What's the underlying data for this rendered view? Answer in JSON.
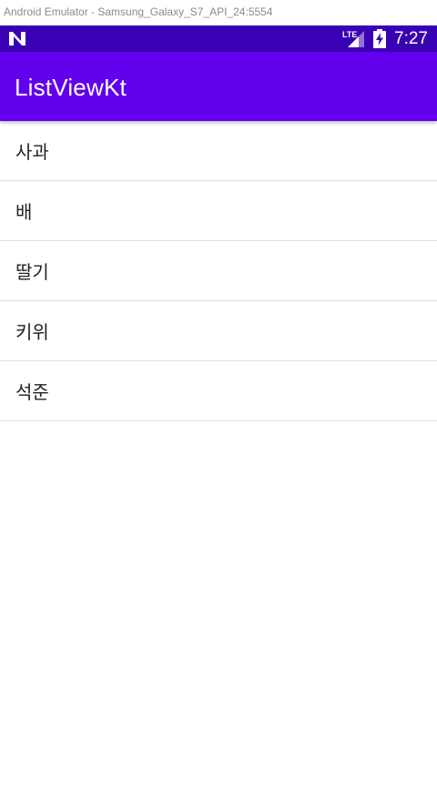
{
  "window": {
    "title": "Android Emulator - Samsung_Galaxy_S7_API_24:5554"
  },
  "status_bar": {
    "network_label": "LTE",
    "time": "7:27",
    "background": "#3a00b4",
    "icons": [
      "notification-n-icon",
      "lte-signal-icon",
      "battery-charging-icon"
    ]
  },
  "app_bar": {
    "title": "ListViewKt",
    "background": "#6200ee"
  },
  "list": {
    "items": [
      {
        "label": "사과"
      },
      {
        "label": "배"
      },
      {
        "label": "딸기"
      },
      {
        "label": "키위"
      },
      {
        "label": "석준"
      }
    ]
  }
}
